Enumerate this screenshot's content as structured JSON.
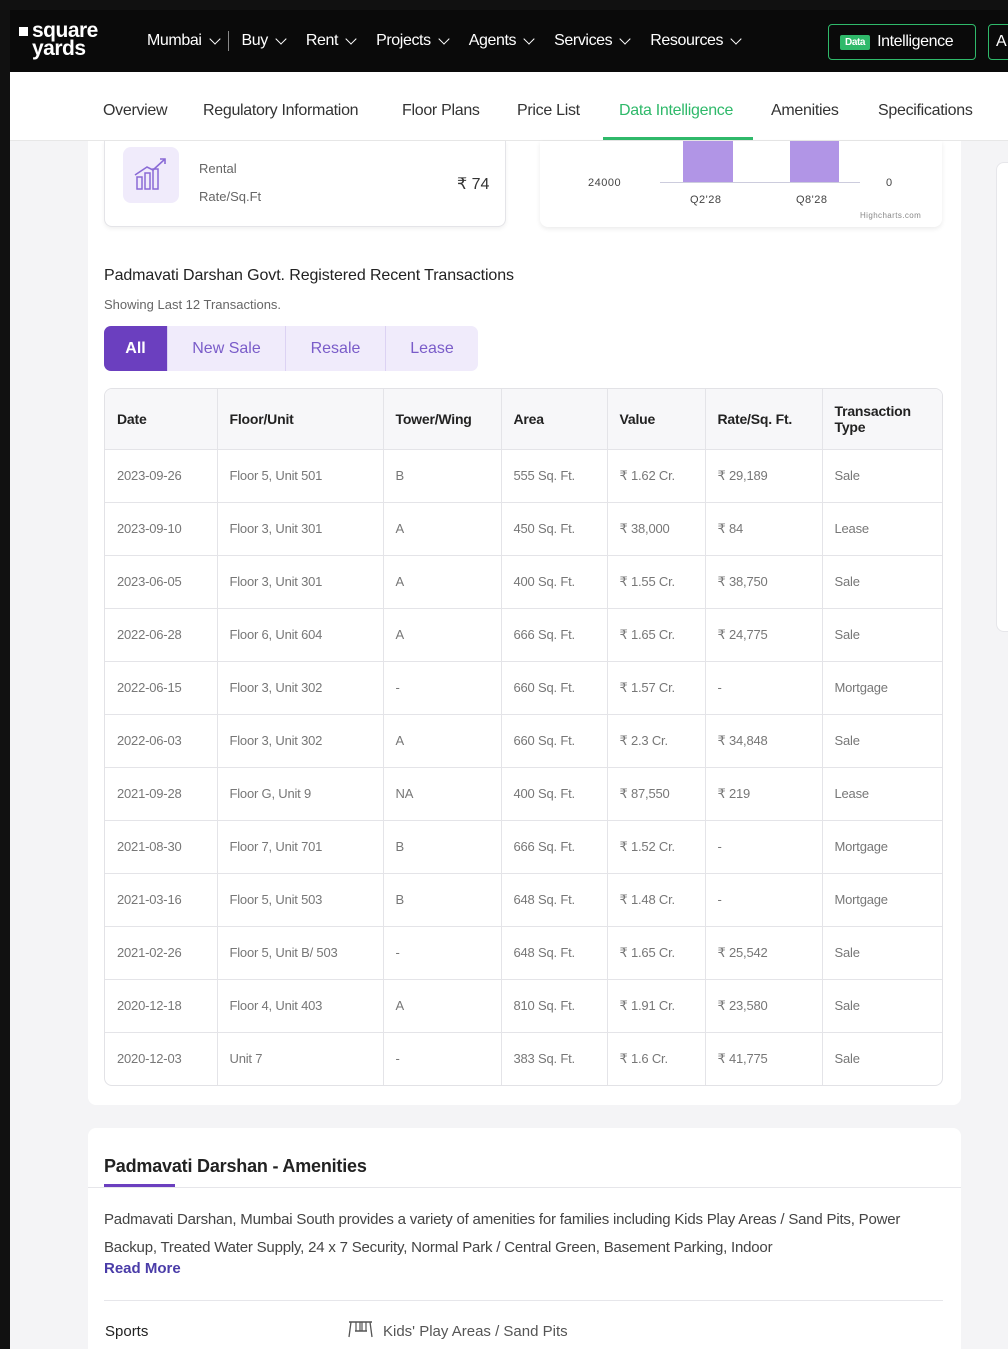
{
  "brand": {
    "line1": "square",
    "line2": "yards"
  },
  "nav": {
    "city": "Mumbai",
    "items": [
      "Buy",
      "Rent",
      "Projects",
      "Agents",
      "Services",
      "Resources"
    ],
    "di_badge": "Data",
    "di_label": "Intelligence",
    "cut_label": "A"
  },
  "subnav": {
    "tabs": [
      "Overview",
      "Regulatory Information",
      "Floor Plans",
      "Price List",
      "Data Intelligence",
      "Amenities",
      "Specifications"
    ],
    "active": "Data Intelligence"
  },
  "rental": {
    "line1": "Rental",
    "line2": "Rate/Sq.Ft",
    "value": "₹ 74"
  },
  "chart_data": {
    "type": "bar",
    "categories": [
      "Q2'28",
      "Q8'28"
    ],
    "y_tick_left": "24000",
    "y_tick_right": "0",
    "credit": "Highcharts.com"
  },
  "transactions": {
    "title": "Padmavati Darshan Govt. Registered Recent Transactions",
    "subtitle": "Showing Last 12 Transactions.",
    "filters": [
      "All",
      "New Sale",
      "Resale",
      "Lease"
    ],
    "active_filter": "All",
    "columns": [
      "Date",
      "Floor/Unit",
      "Tower/Wing",
      "Area",
      "Value",
      "Rate/Sq. Ft.",
      "Transaction Type"
    ],
    "rows": [
      [
        "2023-09-26",
        "Floor 5, Unit 501",
        "B",
        "555 Sq. Ft.",
        "₹ 1.62 Cr.",
        "₹ 29,189",
        "Sale"
      ],
      [
        "2023-09-10",
        "Floor 3, Unit 301",
        "A",
        "450 Sq. Ft.",
        "₹ 38,000",
        "₹ 84",
        "Lease"
      ],
      [
        "2023-06-05",
        "Floor 3, Unit 301",
        "A",
        "400 Sq. Ft.",
        "₹ 1.55 Cr.",
        "₹ 38,750",
        "Sale"
      ],
      [
        "2022-06-28",
        "Floor 6, Unit 604",
        "A",
        "666 Sq. Ft.",
        "₹ 1.65 Cr.",
        "₹ 24,775",
        "Sale"
      ],
      [
        "2022-06-15",
        "Floor 3, Unit 302",
        "-",
        "660 Sq. Ft.",
        "₹ 1.57 Cr.",
        "-",
        "Mortgage"
      ],
      [
        "2022-06-03",
        "Floor 3, Unit 302",
        "A",
        "660 Sq. Ft.",
        "₹ 2.3 Cr.",
        "₹ 34,848",
        "Sale"
      ],
      [
        "2021-09-28",
        "Floor G, Unit 9",
        "NA",
        "400 Sq. Ft.",
        "₹ 87,550",
        "₹ 219",
        "Lease"
      ],
      [
        "2021-08-30",
        "Floor 7, Unit 701",
        "B",
        "666 Sq. Ft.",
        "₹ 1.52 Cr.",
        "-",
        "Mortgage"
      ],
      [
        "2021-03-16",
        "Floor 5, Unit 503",
        "B",
        "648 Sq. Ft.",
        "₹ 1.48 Cr.",
        "-",
        "Mortgage"
      ],
      [
        "2021-02-26",
        "Floor 5, Unit B/ 503",
        "-",
        "648 Sq. Ft.",
        "₹ 1.65 Cr.",
        "₹ 25,542",
        "Sale"
      ],
      [
        "2020-12-18",
        "Floor 4, Unit 403",
        "A",
        "810 Sq. Ft.",
        "₹ 1.91 Cr.",
        "₹ 23,580",
        "Sale"
      ],
      [
        "2020-12-03",
        "Unit 7",
        "-",
        "383 Sq. Ft.",
        "₹ 1.6 Cr.",
        "₹ 41,775",
        "Sale"
      ]
    ]
  },
  "amenities": {
    "title": "Padmavati Darshan - Amenities",
    "description": "Padmavati Darshan, Mumbai South provides a variety of amenities for families including Kids Play Areas / Sand Pits, Power Backup, Treated Water Supply, 24 x 7 Security, Normal Park / Central Green, Basement Parking, Indoor",
    "read_more": "Read More",
    "category": "Sports",
    "first_item": "Kids' Play Areas / Sand Pits"
  },
  "colors": {
    "accent_green": "#2fb96a",
    "accent_purple": "#6b3fbf",
    "bar": "#b195e6"
  }
}
